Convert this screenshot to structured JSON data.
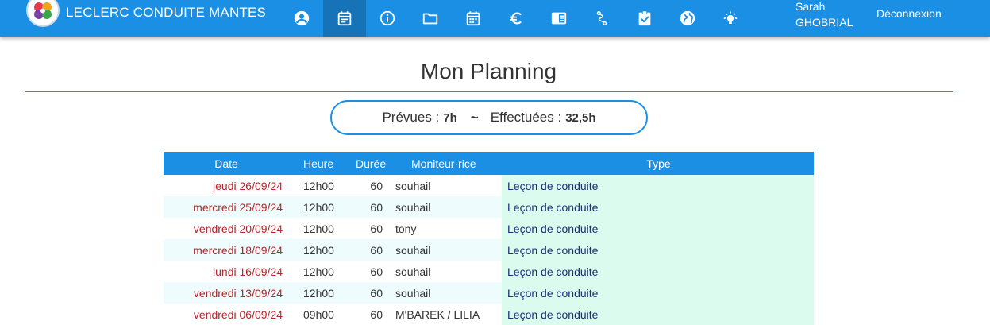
{
  "header": {
    "brand": "LECLERC CONDUITE MANTES",
    "nav_icons": [
      {
        "name": "account-circle-icon",
        "active": false
      },
      {
        "name": "calendar-list-icon",
        "active": true
      },
      {
        "name": "info-icon",
        "active": false
      },
      {
        "name": "folder-icon",
        "active": false
      },
      {
        "name": "calendar-icon",
        "active": false
      },
      {
        "name": "euro-icon",
        "active": false
      },
      {
        "name": "book-icon",
        "active": false
      },
      {
        "name": "route-icon",
        "active": false
      },
      {
        "name": "clipboard-check-icon",
        "active": false
      },
      {
        "name": "globe-icon",
        "active": false
      },
      {
        "name": "lightbulb-icon",
        "active": false
      }
    ],
    "user_name": "Sarah\nGHOBRIAL",
    "logout_label": "Déconnexion",
    "colors": {
      "bar": "#1a8fe3",
      "active": "#1673b7"
    }
  },
  "page": {
    "title": "Mon Planning"
  },
  "summary": {
    "planned_label": "Prévues :",
    "planned_value": "7h",
    "separator": "~",
    "done_label": "Effectuées :",
    "done_value": "32,5h"
  },
  "table": {
    "columns": [
      "Date",
      "Heure",
      "Durée",
      "Moniteur·rice",
      "Type"
    ],
    "rows": [
      {
        "date": "jeudi 26/09/24",
        "heure": "12h00",
        "duree": "60",
        "moniteur": "souhail",
        "type": "Leçon de conduite"
      },
      {
        "date": "mercredi 25/09/24",
        "heure": "12h00",
        "duree": "60",
        "moniteur": "souhail",
        "type": "Leçon de conduite"
      },
      {
        "date": "vendredi 20/09/24",
        "heure": "12h00",
        "duree": "60",
        "moniteur": "tony",
        "type": "Leçon de conduite"
      },
      {
        "date": "mercredi 18/09/24",
        "heure": "12h00",
        "duree": "60",
        "moniteur": "souhail",
        "type": "Leçon de conduite"
      },
      {
        "date": "lundi 16/09/24",
        "heure": "12h00",
        "duree": "60",
        "moniteur": "souhail",
        "type": "Leçon de conduite"
      },
      {
        "date": "vendredi 13/09/24",
        "heure": "12h00",
        "duree": "60",
        "moniteur": "souhail",
        "type": "Leçon de conduite"
      },
      {
        "date": "vendredi 06/09/24",
        "heure": "09h00",
        "duree": "60",
        "moniteur": "M'BAREK / LILIA",
        "type": "Leçon de conduite"
      }
    ]
  }
}
